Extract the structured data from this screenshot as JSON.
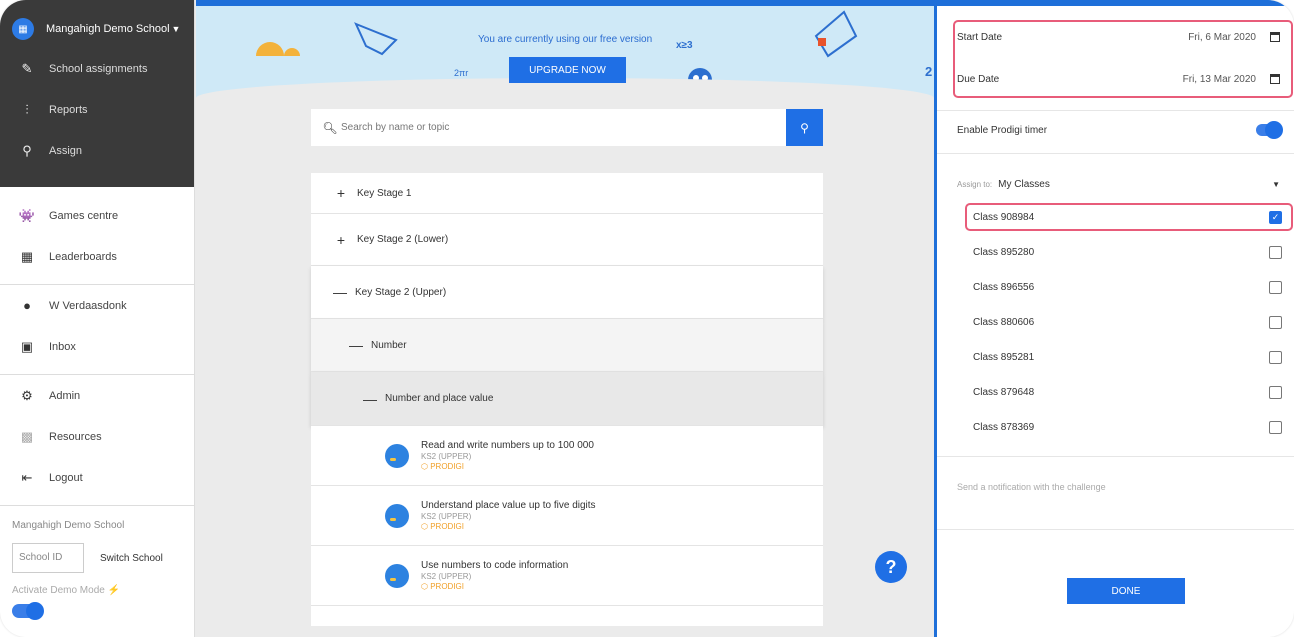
{
  "sidebar": {
    "school_name": "Mangahigh Demo School",
    "dark_items": [
      {
        "label": "School assignments",
        "icon": "edit-icon"
      },
      {
        "label": "Reports",
        "icon": "chart-icon"
      },
      {
        "label": "Assign",
        "icon": "search-icon"
      }
    ],
    "light_items_1": [
      {
        "label": "Games centre",
        "icon": "invader-icon"
      },
      {
        "label": "Leaderboards",
        "icon": "grid-icon"
      }
    ],
    "light_items_2": [
      {
        "label": "W Verdaasdonk",
        "icon": "user-icon"
      },
      {
        "label": "Inbox",
        "icon": "inbox-icon"
      }
    ],
    "light_items_3": [
      {
        "label": "Admin",
        "icon": "admin-icon"
      },
      {
        "label": "Resources",
        "icon": "resources-icon"
      },
      {
        "label": "Logout",
        "icon": "logout-icon"
      }
    ],
    "footer_school": "Mangahigh Demo School",
    "school_id_placeholder": "School ID",
    "switch_school": "Switch School",
    "demo_mode": "Activate Demo Mode"
  },
  "banner": {
    "text": "You are currently using our free version",
    "upgrade": "UPGRADE NOW",
    "math1": "x≥3",
    "math2": "2πr",
    "math3": "2"
  },
  "search": {
    "placeholder": "Search by name or topic"
  },
  "tree": {
    "ks1": "Key Stage 1",
    "ks2_lower": "Key Stage 2 (Lower)",
    "ks2_upper": "Key Stage 2 (Upper)",
    "number": "Number",
    "npv": "Number and place value",
    "plus": "+",
    "minus": "—",
    "topics": [
      {
        "title": "Read and write numbers up to 100 000",
        "ks": "KS2 (UPPER)",
        "brand": "PRODIGI"
      },
      {
        "title": "Understand place value up to five digits",
        "ks": "KS2 (UPPER)",
        "brand": "PRODIGI"
      },
      {
        "title": "Use numbers to code information",
        "ks": "KS2 (UPPER)",
        "brand": "PRODIGI"
      }
    ]
  },
  "help": "?",
  "panel": {
    "start_label": "Start Date",
    "start_value": "Fri, 6 Mar 2020",
    "due_label": "Due Date",
    "due_value": "Fri, 13 Mar 2020",
    "timer_label": "Enable Prodigi timer",
    "assign_label": "Assign to:",
    "assign_value": "My Classes",
    "classes": [
      {
        "name": "Class 908984",
        "checked": true
      },
      {
        "name": "Class 895280",
        "checked": false
      },
      {
        "name": "Class 896556",
        "checked": false
      },
      {
        "name": "Class 880606",
        "checked": false
      },
      {
        "name": "Class 895281",
        "checked": false
      },
      {
        "name": "Class 879648",
        "checked": false
      },
      {
        "name": "Class 878369",
        "checked": false
      }
    ],
    "notify": "Send a notification with the challenge",
    "done": "DONE"
  },
  "colors": {
    "accent": "#1f6fe5",
    "highlight": "#e85c7a",
    "sidebar_dark": "#3a3a3a"
  }
}
